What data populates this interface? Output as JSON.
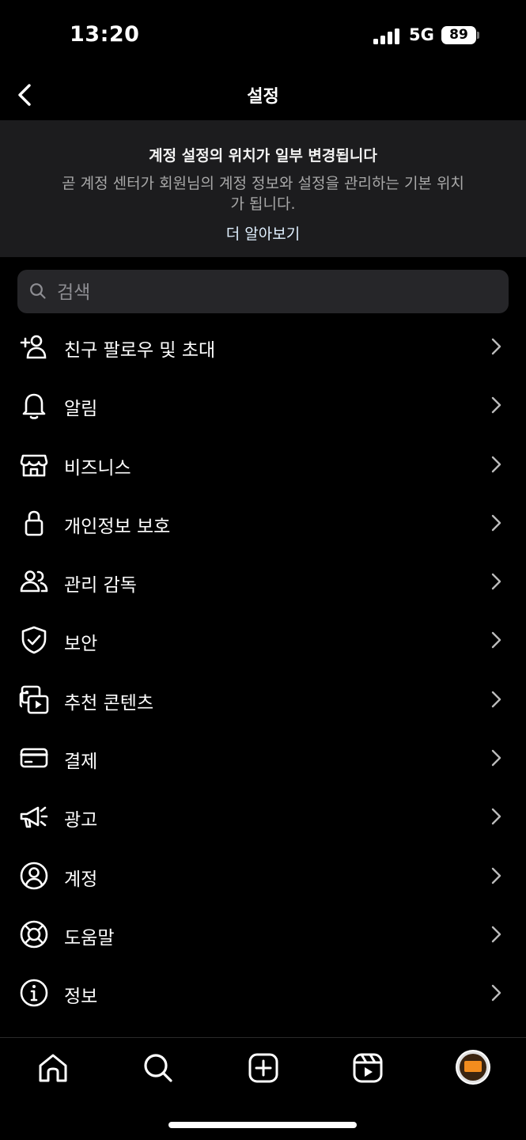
{
  "status": {
    "time": "13:20",
    "network": "5G",
    "battery": "89"
  },
  "header": {
    "title": "설정"
  },
  "banner": {
    "title": "계정 설정의 위치가 일부 변경됩니다",
    "body": "곧 계정 센터가 회원님의 계정 정보와 설정을 관리하는 기본 위치가 됩니다.",
    "link": "더 알아보기"
  },
  "search": {
    "placeholder": "검색",
    "value": ""
  },
  "menu": {
    "items": [
      {
        "label": "친구 팔로우 및 초대",
        "icon": "add-person-icon"
      },
      {
        "label": "알림",
        "icon": "bell-icon"
      },
      {
        "label": "비즈니스",
        "icon": "shop-icon"
      },
      {
        "label": "개인정보 보호",
        "icon": "lock-icon"
      },
      {
        "label": "관리 감독",
        "icon": "people-icon"
      },
      {
        "label": "보안",
        "icon": "shield-check-icon"
      },
      {
        "label": "추천 콘텐츠",
        "icon": "media-play-icon"
      },
      {
        "label": "결제",
        "icon": "credit-card-icon"
      },
      {
        "label": "광고",
        "icon": "megaphone-icon"
      },
      {
        "label": "계정",
        "icon": "account-circle-icon"
      },
      {
        "label": "도움말",
        "icon": "lifebuoy-icon"
      },
      {
        "label": "정보",
        "icon": "info-icon"
      }
    ]
  },
  "tabbar": {
    "tabs": [
      "home-icon",
      "search-icon",
      "create-icon",
      "reels-icon",
      "profile-avatar"
    ]
  },
  "colors": {
    "background": "#000000",
    "banner": "#1c1c1e",
    "search": "#262629",
    "muted": "#a8a8a8"
  }
}
